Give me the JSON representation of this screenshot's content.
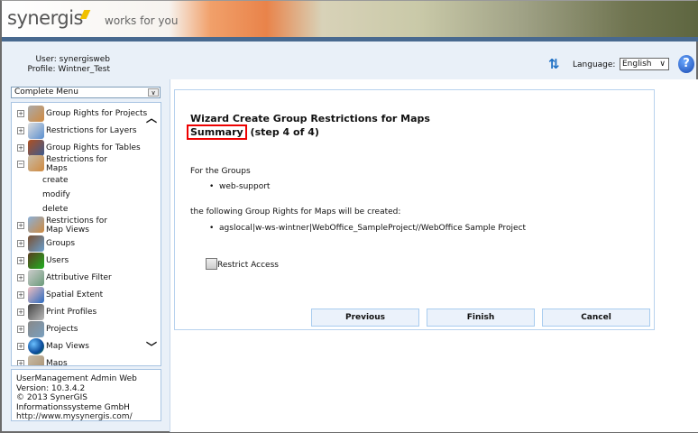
{
  "header": {
    "logo": "synergis",
    "tagline": "works for you"
  },
  "user": {
    "user_line": "User: synergisweb",
    "profile_line": "Profile: Wintner_Test"
  },
  "language": {
    "label": "Language:",
    "selected": "English"
  },
  "sidebar": {
    "menu_select": "Complete Menu",
    "items": [
      {
        "label": "Group Rights for Projects",
        "expanded": false
      },
      {
        "label": "Restrictions for Layers",
        "expanded": false
      },
      {
        "label": "Group Rights for Tables",
        "expanded": false
      },
      {
        "label": "Restrictions for Maps",
        "expanded": true,
        "children": [
          "create",
          "modify",
          "delete"
        ]
      },
      {
        "label": "Restrictions for Map Views",
        "expanded": false
      },
      {
        "label": "Groups",
        "expanded": false
      },
      {
        "label": "Users",
        "expanded": false
      },
      {
        "label": "Attributive Filter",
        "expanded": false
      },
      {
        "label": "Spatial Extent",
        "expanded": false
      },
      {
        "label": "Print Profiles",
        "expanded": false
      },
      {
        "label": "Projects",
        "expanded": false
      },
      {
        "label": "Map Views",
        "expanded": false
      },
      {
        "label": "Maps",
        "expanded": false
      }
    ],
    "footer": {
      "line1": "UserManagement Admin Web",
      "line2": "Version: 10.3.4.2",
      "line3": "© 2013 SynerGIS",
      "line4": "Informationssysteme GmbH",
      "link": "http://www.mysynergis.com/"
    }
  },
  "wizard": {
    "title": "Wizard Create Group Restrictions for Maps",
    "step_name": "Summary",
    "step_info": "(step 4 of 4)",
    "groups_intro": "For the Groups",
    "groups": [
      "web-support"
    ],
    "rights_intro": "the following Group Rights for Maps will be created:",
    "rights": [
      "agslocal|w-ws-wintner|WebOffice_SampleProject//WebOffice Sample Project"
    ],
    "restrict_label": "Restrict Access",
    "restrict_checked": false,
    "buttons": {
      "previous": "Previous",
      "finish": "Finish",
      "cancel": "Cancel"
    }
  }
}
